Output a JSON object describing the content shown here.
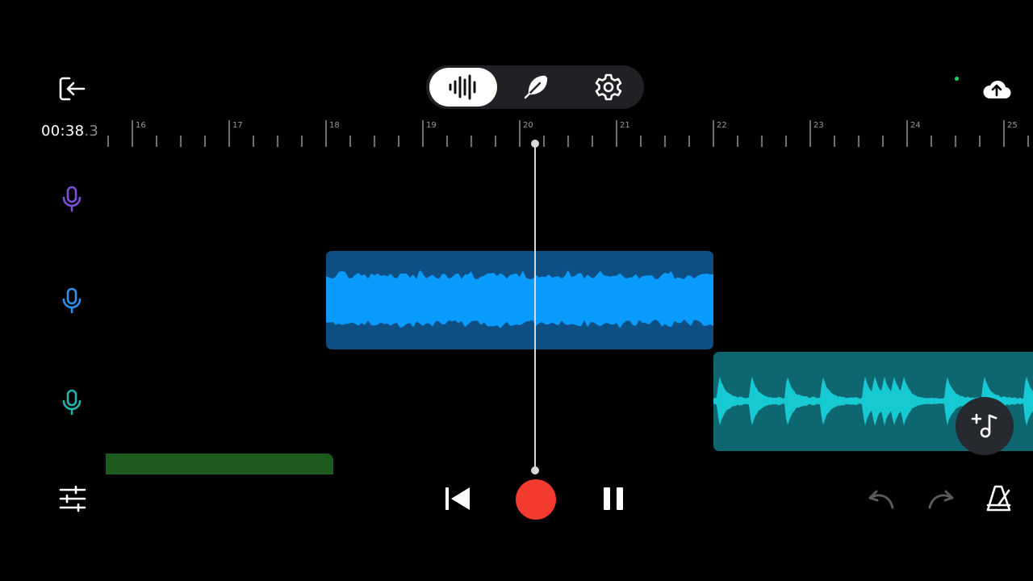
{
  "timecode": {
    "main": "00:38",
    "fraction": ".3"
  },
  "ruler": {
    "labels": [
      "16",
      "17",
      "18",
      "19",
      "20",
      "21",
      "22",
      "23",
      "24",
      "25"
    ]
  },
  "mode_switch": {
    "options": [
      {
        "icon": "waveform-icon",
        "selected": true
      },
      {
        "icon": "feather-icon",
        "selected": false
      },
      {
        "icon": "gear-icon",
        "selected": false
      }
    ]
  },
  "tracks": [
    {
      "icon": "microphone-icon",
      "color": "#7b4fd6"
    },
    {
      "icon": "microphone-icon",
      "color": "#2f8fe6"
    },
    {
      "icon": "microphone-icon",
      "color": "#1fb3ad"
    }
  ],
  "clips": [
    {
      "track": 2,
      "color": "#0d4f82",
      "wave_color": "#0a9bff"
    },
    {
      "track": 3,
      "color": "#0d6670",
      "wave_color": "#17c9d2"
    },
    {
      "track": 4,
      "color": "#1d5a20"
    }
  ],
  "colors": {
    "record": "#f23b2e",
    "status_dot": "#1ed760",
    "disabled": "#5a5a5a"
  },
  "toolbar": {
    "left": [
      "exit-icon"
    ],
    "right": [
      "cloud-upload-icon"
    ],
    "transport": [
      "skip-to-start-icon",
      "record-icon",
      "pause-icon"
    ],
    "bottom_left": [
      "mixer-sliders-icon"
    ],
    "bottom_right": [
      "undo-icon",
      "redo-icon",
      "metronome-icon"
    ]
  }
}
